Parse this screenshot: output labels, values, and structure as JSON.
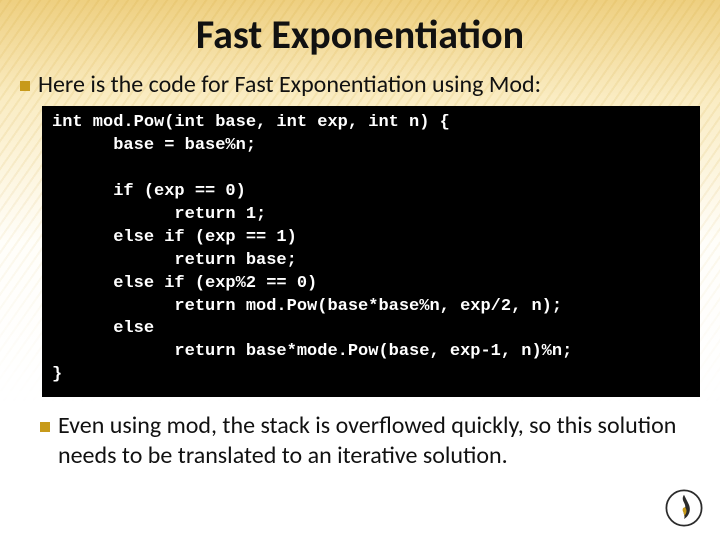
{
  "title": "Fast Exponentiation",
  "bullets": {
    "intro": "Here is the code for Fast Exponentiation using Mod:",
    "outro": "Even using mod, the stack is overflowed quickly, so this solution needs to be translated to an iterative solution."
  },
  "code": "int mod.Pow(int base, int exp, int n) {\n      base = base%n;\n\n      if (exp == 0)\n            return 1;\n      else if (exp == 1)\n            return base;\n      else if (exp%2 == 0)\n            return mod.Pow(base*base%n, exp/2, n);\n      else\n            return base*mode.Pow(base, exp-1, n)%n;\n}",
  "logo_color": "#2b2b2b",
  "logo_accent": "#c79a1a"
}
